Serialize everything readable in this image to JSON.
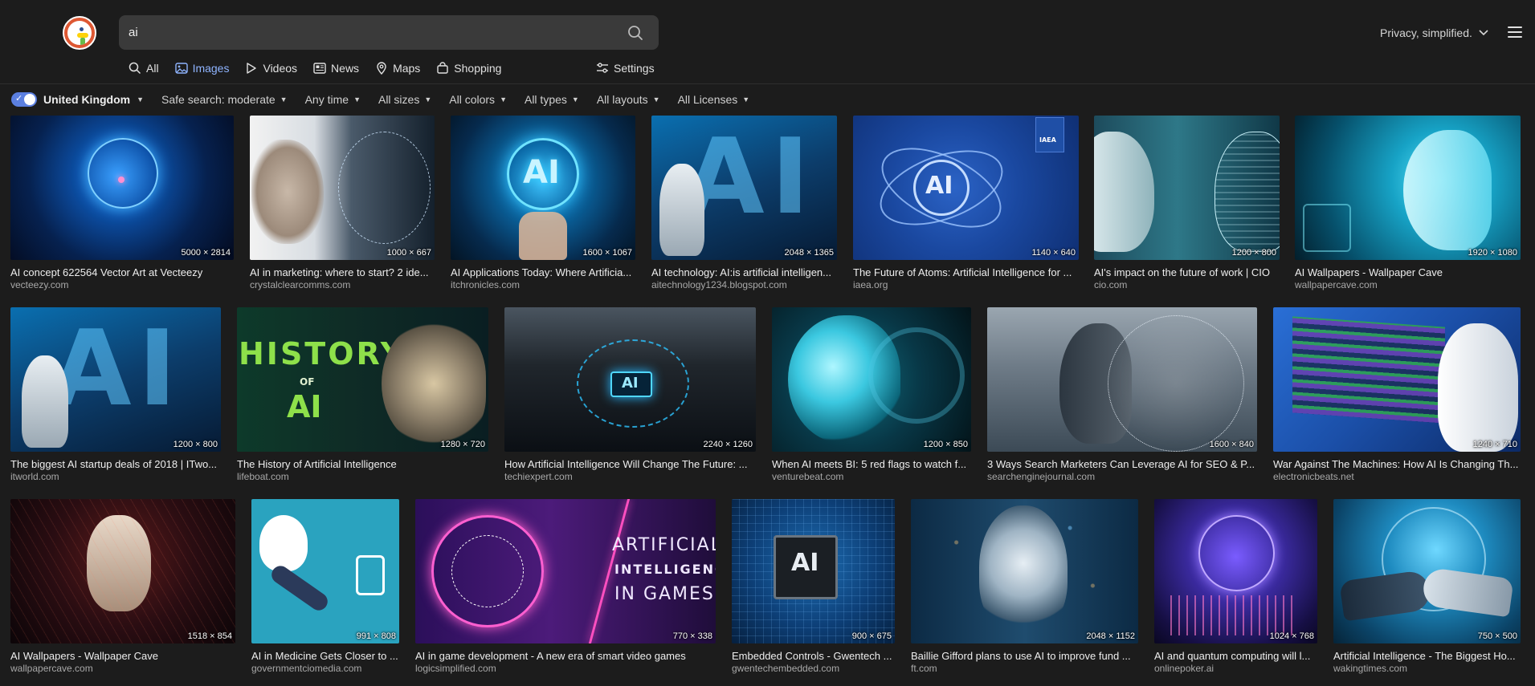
{
  "search": {
    "query": "ai"
  },
  "tabs": [
    {
      "label": "All",
      "icon": "search-icon"
    },
    {
      "label": "Images",
      "icon": "image-icon"
    },
    {
      "label": "Videos",
      "icon": "play-icon"
    },
    {
      "label": "News",
      "icon": "news-icon"
    },
    {
      "label": "Maps",
      "icon": "map-pin-icon"
    },
    {
      "label": "Shopping",
      "icon": "shopping-bag-icon"
    }
  ],
  "settings_label": "Settings",
  "privacy_label": "Privacy, simplified.",
  "filters": {
    "region": "United Kingdom",
    "items": [
      "Safe search: moderate",
      "Any time",
      "All sizes",
      "All colors",
      "All types",
      "All layouts",
      "All Licenses"
    ]
  },
  "colors": {
    "accent": "#8fb4ff",
    "toggle": "#5b7fe0",
    "brand": "#de5833"
  },
  "images": [
    {
      "title": "AI concept 622564 Vector Art at Vecteezy",
      "source": "vecteezy.com",
      "dims": "5000 × 2814"
    },
    {
      "title": "AI in marketing: where to start? 2 ide...",
      "source": "crystalclearcomms.com",
      "dims": "1000 × 667"
    },
    {
      "title": "AI Applications Today: Where Artificia...",
      "source": "itchronicles.com",
      "dims": "1600 × 1067"
    },
    {
      "title": "AI technology: AI:is artificial intelligen...",
      "source": "aitechnology1234.blogspot.com",
      "dims": "2048 × 1365"
    },
    {
      "title": "The Future of Atoms: Artificial Intelligence for ...",
      "source": "iaea.org",
      "dims": "1140 × 640"
    },
    {
      "title": "AI's impact on the future of work | CIO",
      "source": "cio.com",
      "dims": "1200 × 800"
    },
    {
      "title": "AI Wallpapers - Wallpaper Cave",
      "source": "wallpapercave.com",
      "dims": "1920 × 1080"
    },
    {
      "title": "The biggest AI startup deals of 2018 | ITwo...",
      "source": "itworld.com",
      "dims": "1200 × 800"
    },
    {
      "title": "The History of Artificial Intelligence",
      "source": "lifeboat.com",
      "dims": "1280 × 720"
    },
    {
      "title": "How Artificial Intelligence Will Change The Future: ...",
      "source": "techiexpert.com",
      "dims": "2240 × 1260"
    },
    {
      "title": "When AI meets BI: 5 red flags to watch f...",
      "source": "venturebeat.com",
      "dims": "1200 × 850"
    },
    {
      "title": "3 Ways Search Marketers Can Leverage AI for SEO & P...",
      "source": "searchenginejournal.com",
      "dims": "1600 × 840"
    },
    {
      "title": "War Against The Machines: How AI Is Changing Th...",
      "source": "electronicbeats.net",
      "dims": "1240 × 710"
    },
    {
      "title": "AI Wallpapers - Wallpaper Cave",
      "source": "wallpapercave.com",
      "dims": "1518 × 854"
    },
    {
      "title": "AI in Medicine Gets Closer to ...",
      "source": "governmentciomedia.com",
      "dims": "991 × 808"
    },
    {
      "title": "AI in game development - A new era of smart video games",
      "source": "logicsimplified.com",
      "dims": "770 × 338"
    },
    {
      "title": "Embedded Controls - Gwentech ...",
      "source": "gwentechembedded.com",
      "dims": "900 × 675"
    },
    {
      "title": "Baillie Gifford plans to use AI to improve fund ...",
      "source": "ft.com",
      "dims": "2048 × 1152"
    },
    {
      "title": "AI and quantum computing will l...",
      "source": "onlinepoker.ai",
      "dims": "1024 × 768"
    },
    {
      "title": "Artificial Intelligence - The Biggest Ho...",
      "source": "wakingtimes.com",
      "dims": "750 × 500"
    }
  ],
  "image_text": {
    "history": "HISTORY",
    "of": "OF",
    "ai": "AI",
    "games_1": "ARTIFICIAL",
    "games_2": "INTELLIGENCE",
    "games_3": "IN GAMES",
    "iaea": "IAEA"
  }
}
